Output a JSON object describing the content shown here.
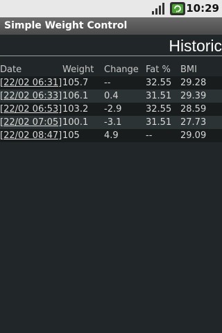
{
  "status_bar": {
    "time": "10:29",
    "icons": [
      "signal-icon",
      "sync-icon"
    ]
  },
  "app": {
    "title": "Simple Weight Control"
  },
  "page": {
    "heading": "Historic"
  },
  "table": {
    "headers": {
      "date": "Date",
      "weight": "Weight",
      "change": "Change",
      "fat": "Fat %",
      "bmi": "BMI"
    },
    "rows": [
      {
        "date": "[22/02 06:31]",
        "weight": "105.7",
        "change": "--",
        "fat": "32.55",
        "bmi": "29.28"
      },
      {
        "date": "[22/02 06:33]",
        "weight": "106.1",
        "change": "0.4",
        "fat": "31.51",
        "bmi": "29.39"
      },
      {
        "date": "[22/02 06:53]",
        "weight": "103.2",
        "change": "-2.9",
        "fat": "32.55",
        "bmi": "28.59"
      },
      {
        "date": "[22/02 07:05]",
        "weight": "100.1",
        "change": "-3.1",
        "fat": "31.51",
        "bmi": "27.73"
      },
      {
        "date": "[22/02 08:47]",
        "weight": "105",
        "change": "4.9",
        "fat": "--",
        "bmi": "29.09"
      }
    ]
  }
}
